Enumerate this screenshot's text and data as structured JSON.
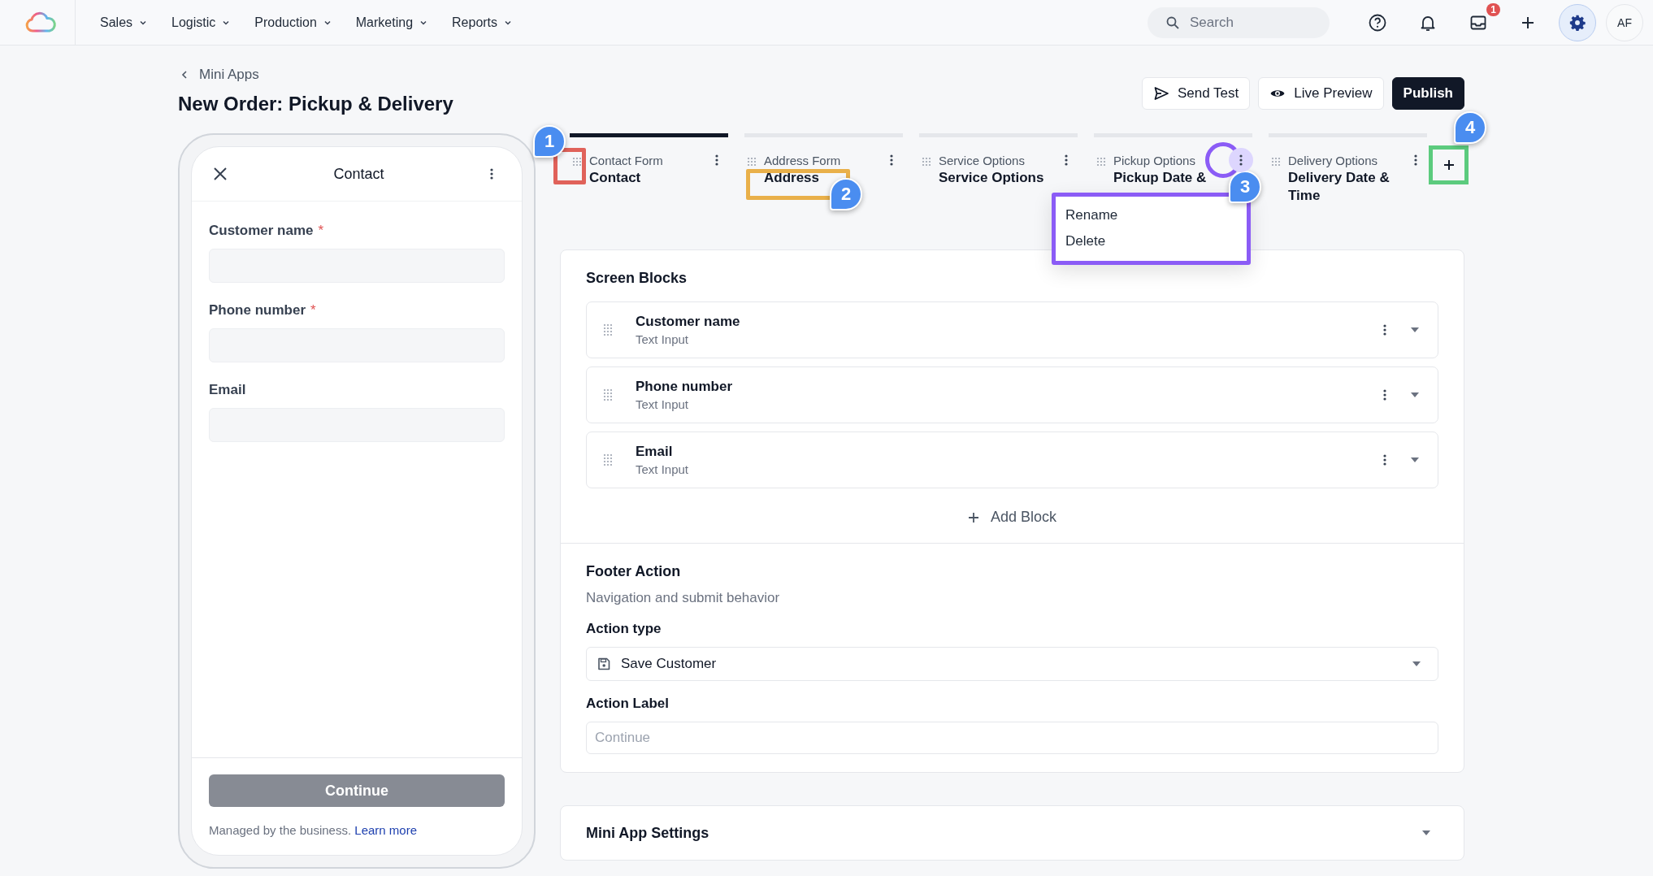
{
  "top_nav": {
    "menu": [
      {
        "label": "Sales"
      },
      {
        "label": "Logistic"
      },
      {
        "label": "Production"
      },
      {
        "label": "Marketing"
      },
      {
        "label": "Reports"
      }
    ],
    "search": {
      "placeholder": "Search"
    },
    "inbox_badge": "1",
    "avatar": "AF"
  },
  "header": {
    "back_link": "Mini Apps",
    "title": "New Order: Pickup & Delivery",
    "buttons": [
      {
        "label": "Send Test",
        "kind": "send"
      },
      {
        "label": "Live Preview",
        "kind": "preview"
      },
      {
        "label": "Publish",
        "kind": "primary"
      }
    ]
  },
  "phone_preview": {
    "title": "Contact",
    "fields": [
      {
        "label": "Customer name",
        "required_mark": "*"
      },
      {
        "label": "Phone number",
        "required_mark": "*"
      },
      {
        "label": "Email"
      }
    ],
    "button": "Continue",
    "footer_note": "Managed by the business.",
    "footer_link": "Learn more"
  },
  "steps": [
    {
      "label": "Contact Form",
      "title": "Contact",
      "selected": true,
      "menu_open": false
    },
    {
      "label": "Address Form",
      "title": "Address",
      "selected": false,
      "menu_open": false
    },
    {
      "label": "Service Options",
      "title": "Service Options",
      "selected": false,
      "menu_open": false
    },
    {
      "label": "Pickup Options",
      "title": "Pickup Date &",
      "selected": false,
      "menu_open": true
    },
    {
      "label": "Delivery Options",
      "title": "Delivery Date & Time",
      "selected": false,
      "menu_open": false
    }
  ],
  "step_menu": {
    "items": [
      "Rename",
      "Delete"
    ]
  },
  "annotations": [
    {
      "number": "1",
      "color": "#e0625a",
      "kind": "handle"
    },
    {
      "number": "2",
      "color": "#e9b04a",
      "kind": "title"
    },
    {
      "number": "3",
      "color": "#8b5cf6",
      "kind": "menu"
    },
    {
      "number": "4",
      "color": "#5ccb7e",
      "kind": "add"
    }
  ],
  "screen_blocks": {
    "title": "Screen Blocks",
    "blocks": [
      {
        "name": "Customer name",
        "type": "Text Input"
      },
      {
        "name": "Phone number",
        "type": "Text Input"
      },
      {
        "name": "Email",
        "type": "Text Input"
      }
    ],
    "add_label": "Add Block"
  },
  "footer_action": {
    "title": "Footer Action",
    "subtitle": "Navigation and submit behavior",
    "action_type_label": "Action type",
    "action_type": "Save Customer",
    "action_label_label": "Action Label",
    "action_label_placeholder": "Continue"
  },
  "settings": {
    "title": "Mini App Settings",
    "expanded": false
  }
}
